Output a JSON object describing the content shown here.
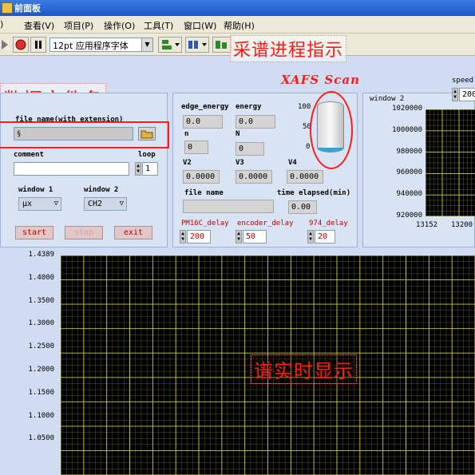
{
  "window": {
    "title": "前面板"
  },
  "menu": [
    "查看(V)",
    "项目(P)",
    "操作(O)",
    "工具(T)",
    "窗口(W)",
    "帮助(H)"
  ],
  "toolbar": {
    "font_label": "12pt 应用程序字体"
  },
  "annotations": {
    "progress": "采谱进程指示",
    "filename": "数据文件名",
    "realtime": "谱实时显示"
  },
  "left_panel": {
    "file_label": "file name(with extension)",
    "file_value": "",
    "comment_label": "comment",
    "comment_value": "",
    "loop_label": "loop",
    "loop_value": "1",
    "window1_label": "window 1",
    "window1_value": "μx",
    "window2_label": "window 2",
    "window2_value": "CH2",
    "start_label": "start",
    "stop_label": "stop",
    "exit_label": "exit"
  },
  "mid_panel": {
    "title": "XAFS Scan",
    "edge_energy_label": "edge_energy",
    "edge_energy_value": "0.0",
    "energy_label": "energy",
    "energy_value": "0.0",
    "n_label": "n",
    "n_value": "0",
    "N_label": "N",
    "N_value": "0",
    "v2_label": "V2",
    "v2_value": "0.0000",
    "v3_label": "V3",
    "v3_value": "0.0000",
    "v4_label": "V4",
    "v4_value": "0.0000",
    "filename_label": "file name",
    "filename_value": "",
    "elapsed_label": "time elapsed(min)",
    "elapsed_value": "0.00",
    "pm16c_label": "PM16C_delay",
    "pm16c_value": "200",
    "encoder_label": "encoder_delay",
    "encoder_value": "50",
    "d974_label": "974_delay",
    "d974_value": "20",
    "tank_ticks": [
      "100",
      "50",
      "0"
    ],
    "tank_level": 0.0
  },
  "right_panel": {
    "window_label": "window 2",
    "speed_label": "speed",
    "speed_value": "200",
    "y_ticks": [
      "1020000",
      "1000000",
      "980000",
      "960000",
      "940000",
      "920000"
    ],
    "x_ticks": [
      "13152",
      "13200"
    ]
  },
  "main_graph": {
    "y_ticks": [
      "1.4389",
      "1.4000",
      "1.3500",
      "1.3000",
      "1.2500",
      "1.2000",
      "1.1500",
      "1.1000",
      "1.0500"
    ]
  },
  "colors": {
    "annotation": "#ff1a1a",
    "plot_bg": "#000000",
    "grid": "#d8d830",
    "panel": "#d8e4f4"
  }
}
